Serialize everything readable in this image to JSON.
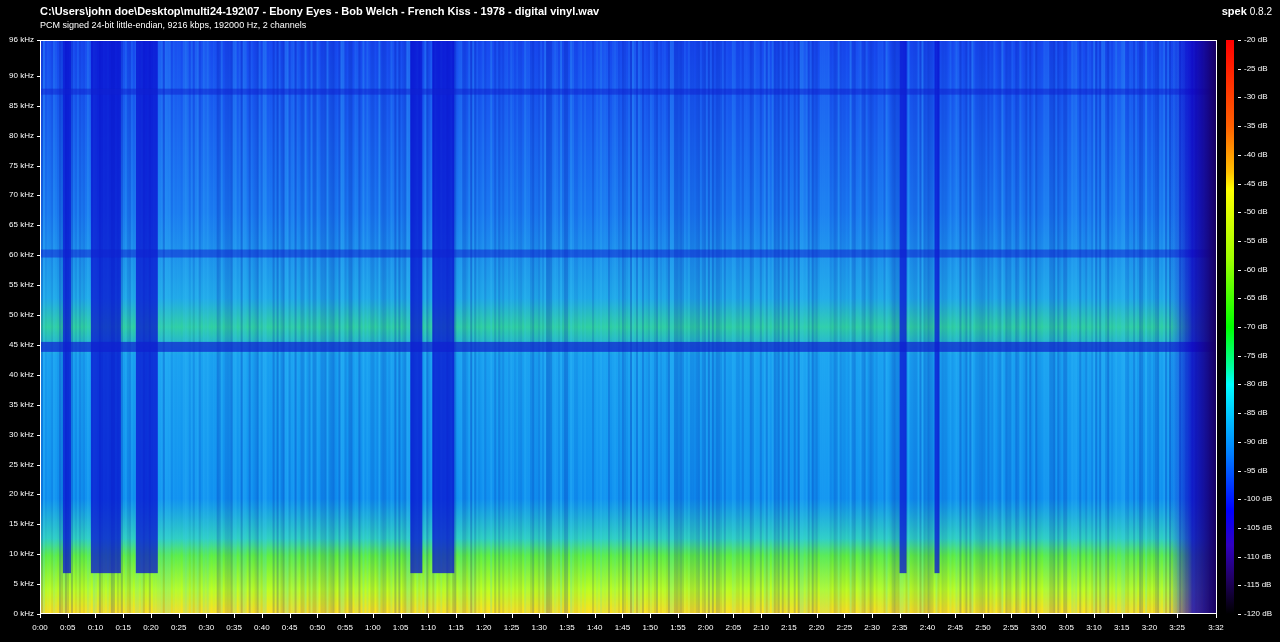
{
  "header": {
    "file_path": "C:\\Users\\john doe\\Desktop\\multi24-192\\07 - Ebony Eyes - Bob Welch - French Kiss - 1978 - digital vinyl.wav",
    "format_info": "PCM signed 24-bit little-endian, 9216 kbps, 192000 Hz, 2 channels"
  },
  "app": {
    "name": "spek",
    "version": "0.8.2"
  },
  "spectrogram": {
    "frequency_labels": [
      "96 kHz",
      "90 kHz",
      "85 kHz",
      "80 kHz",
      "75 kHz",
      "70 kHz",
      "65 kHz",
      "60 kHz",
      "55 kHz",
      "50 kHz",
      "45 kHz",
      "40 kHz",
      "35 kHz",
      "30 kHz",
      "25 kHz",
      "20 kHz",
      "15 kHz",
      "10 kHz",
      "5 kHz",
      "0 kHz"
    ],
    "time_labels": [
      "0:00",
      "0:05",
      "0:10",
      "0:15",
      "0:20",
      "0:25",
      "0:30",
      "0:35",
      "0:40",
      "0:45",
      "0:50",
      "0:55",
      "1:00",
      "1:05",
      "1:10",
      "1:15",
      "1:20",
      "1:25",
      "1:30",
      "1:35",
      "1:40",
      "1:45",
      "1:50",
      "1:55",
      "2:00",
      "2:05",
      "2:10",
      "2:15",
      "2:20",
      "2:25",
      "2:30",
      "2:35",
      "2:40",
      "2:45",
      "2:50",
      "2:55",
      "3:00",
      "3:05",
      "3:10",
      "3:15",
      "3:20",
      "3:25",
      "3:32"
    ]
  },
  "color_scale": {
    "labels": [
      "-20 dB",
      "-25 dB",
      "-30 dB",
      "-35 dB",
      "-40 dB",
      "-45 dB",
      "-50 dB",
      "-55 dB",
      "-60 dB",
      "-65 dB",
      "-70 dB",
      "-75 dB",
      "-80 dB",
      "-85 dB",
      "-90 dB",
      "-95 dB",
      "-100 dB",
      "-105 dB",
      "-110 dB",
      "-115 dB",
      "-120 dB"
    ]
  }
}
